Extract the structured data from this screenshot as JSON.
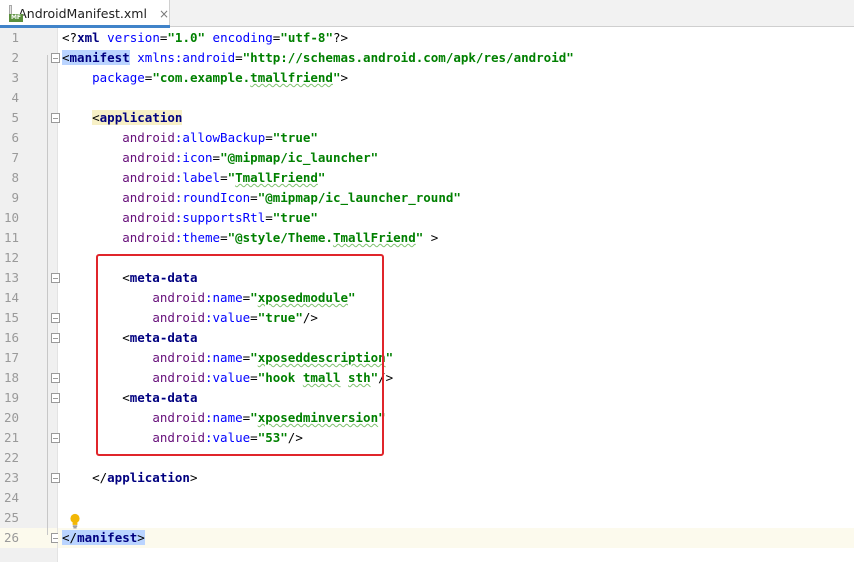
{
  "tab": {
    "title": "AndroidManifest.xml",
    "icon_badge": "MF",
    "close_glyph": "×"
  },
  "colors": {
    "tag": "#000080",
    "attribute": "#0000ff",
    "namespace": "#660e7a",
    "value": "#008000",
    "highlight_box": "#e0252b",
    "current_line": "#fcfaed"
  },
  "editor": {
    "current_line": 26,
    "lines": [
      {
        "n": "1",
        "tokens": [
          {
            "t": "<?",
            "c": "punct"
          },
          {
            "t": "xml",
            "c": "tag"
          },
          {
            "t": " version",
            "c": "attr"
          },
          {
            "t": "=",
            "c": "punct"
          },
          {
            "t": "\"1.0\"",
            "c": "val"
          },
          {
            "t": " encoding",
            "c": "attr"
          },
          {
            "t": "=",
            "c": "punct"
          },
          {
            "t": "\"utf-8\"",
            "c": "val"
          },
          {
            "t": "?>",
            "c": "punct"
          }
        ]
      },
      {
        "n": "2",
        "tokens": [
          {
            "t": "<",
            "c": "punct match"
          },
          {
            "t": "manifest",
            "c": "tag match"
          },
          {
            "t": " xmlns:android",
            "c": "attr"
          },
          {
            "t": "=",
            "c": "punct"
          },
          {
            "t": "\"http://schemas.android.com/apk/res/android\"",
            "c": "val"
          }
        ]
      },
      {
        "n": "3",
        "tokens": [
          {
            "t": "    package",
            "c": "attr"
          },
          {
            "t": "=",
            "c": "punct"
          },
          {
            "t": "\"com.example.",
            "c": "val"
          },
          {
            "t": "tmallfriend",
            "c": "val spell"
          },
          {
            "t": "\"",
            "c": "val"
          },
          {
            "t": ">",
            "c": "punct"
          }
        ]
      },
      {
        "n": "4",
        "tokens": []
      },
      {
        "n": "5",
        "tokens": [
          {
            "t": "    ",
            "c": "punct"
          },
          {
            "t": "<",
            "c": "punct app"
          },
          {
            "t": "application",
            "c": "tag app"
          }
        ]
      },
      {
        "n": "6",
        "tokens": [
          {
            "t": "        ",
            "c": "punct"
          },
          {
            "t": "android",
            "c": "ns"
          },
          {
            "t": ":allowBackup",
            "c": "attr"
          },
          {
            "t": "=",
            "c": "punct"
          },
          {
            "t": "\"true\"",
            "c": "val"
          }
        ]
      },
      {
        "n": "7",
        "tokens": [
          {
            "t": "        ",
            "c": "punct"
          },
          {
            "t": "android",
            "c": "ns"
          },
          {
            "t": ":icon",
            "c": "attr"
          },
          {
            "t": "=",
            "c": "punct"
          },
          {
            "t": "\"@mipmap/ic_launcher\"",
            "c": "val"
          }
        ]
      },
      {
        "n": "8",
        "tokens": [
          {
            "t": "        ",
            "c": "punct"
          },
          {
            "t": "android",
            "c": "ns"
          },
          {
            "t": ":label",
            "c": "attr"
          },
          {
            "t": "=",
            "c": "punct"
          },
          {
            "t": "\"",
            "c": "val"
          },
          {
            "t": "TmallFriend",
            "c": "val spell"
          },
          {
            "t": "\"",
            "c": "val"
          }
        ]
      },
      {
        "n": "9",
        "tokens": [
          {
            "t": "        ",
            "c": "punct"
          },
          {
            "t": "android",
            "c": "ns"
          },
          {
            "t": ":roundIcon",
            "c": "attr"
          },
          {
            "t": "=",
            "c": "punct"
          },
          {
            "t": "\"@mipmap/ic_launcher_round\"",
            "c": "val"
          }
        ]
      },
      {
        "n": "10",
        "tokens": [
          {
            "t": "        ",
            "c": "punct"
          },
          {
            "t": "android",
            "c": "ns"
          },
          {
            "t": ":supportsRtl",
            "c": "attr"
          },
          {
            "t": "=",
            "c": "punct"
          },
          {
            "t": "\"true\"",
            "c": "val"
          }
        ]
      },
      {
        "n": "11",
        "tokens": [
          {
            "t": "        ",
            "c": "punct"
          },
          {
            "t": "android",
            "c": "ns"
          },
          {
            "t": ":theme",
            "c": "attr"
          },
          {
            "t": "=",
            "c": "punct"
          },
          {
            "t": "\"@style/Theme.",
            "c": "val"
          },
          {
            "t": "TmallFriend",
            "c": "val spell"
          },
          {
            "t": "\"",
            "c": "val"
          },
          {
            "t": " >",
            "c": "punct"
          }
        ]
      },
      {
        "n": "12",
        "tokens": []
      },
      {
        "n": "13",
        "tokens": [
          {
            "t": "        <",
            "c": "punct"
          },
          {
            "t": "meta-data",
            "c": "tag"
          }
        ]
      },
      {
        "n": "14",
        "tokens": [
          {
            "t": "            ",
            "c": "punct"
          },
          {
            "t": "android",
            "c": "ns"
          },
          {
            "t": ":name",
            "c": "attr"
          },
          {
            "t": "=",
            "c": "punct"
          },
          {
            "t": "\"",
            "c": "val"
          },
          {
            "t": "xposedmodule",
            "c": "val spell"
          },
          {
            "t": "\"",
            "c": "val"
          }
        ]
      },
      {
        "n": "15",
        "tokens": [
          {
            "t": "            ",
            "c": "punct"
          },
          {
            "t": "android",
            "c": "ns"
          },
          {
            "t": ":value",
            "c": "attr"
          },
          {
            "t": "=",
            "c": "punct"
          },
          {
            "t": "\"true\"",
            "c": "val"
          },
          {
            "t": "/>",
            "c": "punct"
          }
        ]
      },
      {
        "n": "16",
        "tokens": [
          {
            "t": "        <",
            "c": "punct"
          },
          {
            "t": "meta-data",
            "c": "tag"
          }
        ]
      },
      {
        "n": "17",
        "tokens": [
          {
            "t": "            ",
            "c": "punct"
          },
          {
            "t": "android",
            "c": "ns"
          },
          {
            "t": ":name",
            "c": "attr"
          },
          {
            "t": "=",
            "c": "punct"
          },
          {
            "t": "\"",
            "c": "val"
          },
          {
            "t": "xposeddescription",
            "c": "val spell"
          },
          {
            "t": "\"",
            "c": "val"
          }
        ]
      },
      {
        "n": "18",
        "tokens": [
          {
            "t": "            ",
            "c": "punct"
          },
          {
            "t": "android",
            "c": "ns"
          },
          {
            "t": ":value",
            "c": "attr"
          },
          {
            "t": "=",
            "c": "punct"
          },
          {
            "t": "\"hook ",
            "c": "val"
          },
          {
            "t": "tmall",
            "c": "val spell"
          },
          {
            "t": " ",
            "c": "val"
          },
          {
            "t": "sth",
            "c": "val spell"
          },
          {
            "t": "\"",
            "c": "val"
          },
          {
            "t": "/>",
            "c": "punct"
          }
        ]
      },
      {
        "n": "19",
        "tokens": [
          {
            "t": "        <",
            "c": "punct"
          },
          {
            "t": "meta-data",
            "c": "tag"
          }
        ]
      },
      {
        "n": "20",
        "tokens": [
          {
            "t": "            ",
            "c": "punct"
          },
          {
            "t": "android",
            "c": "ns"
          },
          {
            "t": ":name",
            "c": "attr"
          },
          {
            "t": "=",
            "c": "punct"
          },
          {
            "t": "\"",
            "c": "val"
          },
          {
            "t": "xposedminversion",
            "c": "val spell"
          },
          {
            "t": "\"",
            "c": "val"
          }
        ]
      },
      {
        "n": "21",
        "tokens": [
          {
            "t": "            ",
            "c": "punct"
          },
          {
            "t": "android",
            "c": "ns"
          },
          {
            "t": ":value",
            "c": "attr"
          },
          {
            "t": "=",
            "c": "punct"
          },
          {
            "t": "\"53\"",
            "c": "val"
          },
          {
            "t": "/>",
            "c": "punct"
          }
        ]
      },
      {
        "n": "22",
        "tokens": []
      },
      {
        "n": "23",
        "tokens": [
          {
            "t": "    </",
            "c": "punct"
          },
          {
            "t": "application",
            "c": "tag"
          },
          {
            "t": ">",
            "c": "punct"
          }
        ]
      },
      {
        "n": "24",
        "tokens": []
      },
      {
        "n": "25",
        "tokens": []
      },
      {
        "n": "26",
        "tokens": [
          {
            "t": "</",
            "c": "punct match"
          },
          {
            "t": "manifest",
            "c": "tag match"
          },
          {
            "t": ">",
            "c": "punct match"
          }
        ]
      }
    ]
  }
}
